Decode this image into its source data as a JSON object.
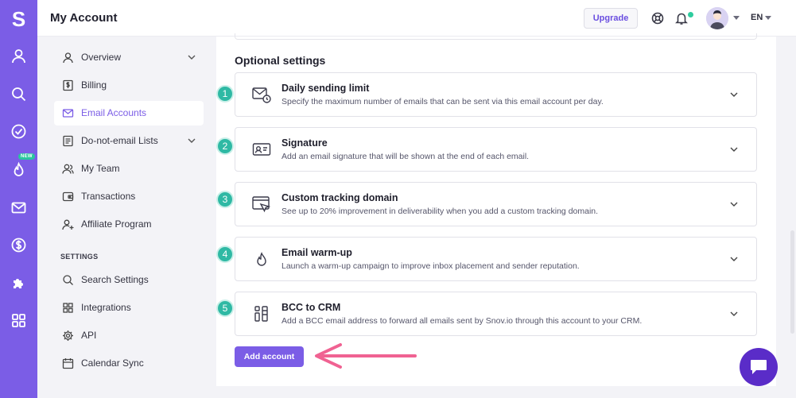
{
  "app": {
    "logo_letter": "S",
    "new_badge": "NEW"
  },
  "header": {
    "title": "My Account",
    "upgrade_label": "Upgrade",
    "language": "EN"
  },
  "sidebar": {
    "items": [
      {
        "label": "Overview",
        "icon": "user-icon",
        "has_chevron": true,
        "active": false
      },
      {
        "label": "Billing",
        "icon": "billing-icon",
        "has_chevron": false,
        "active": false
      },
      {
        "label": "Email Accounts",
        "icon": "mail-icon",
        "has_chevron": false,
        "active": true
      },
      {
        "label": "Do-not-email Lists",
        "icon": "list-icon",
        "has_chevron": true,
        "active": false
      },
      {
        "label": "My Team",
        "icon": "team-icon",
        "has_chevron": false,
        "active": false
      },
      {
        "label": "Transactions",
        "icon": "wallet-icon",
        "has_chevron": false,
        "active": false
      },
      {
        "label": "Affiliate Program",
        "icon": "affiliate-icon",
        "has_chevron": false,
        "active": false
      }
    ],
    "settings_heading": "SETTINGS",
    "settings_items": [
      {
        "label": "Search Settings",
        "icon": "search-icon"
      },
      {
        "label": "Integrations",
        "icon": "integrations-icon"
      },
      {
        "label": "API",
        "icon": "gear-icon"
      },
      {
        "label": "Calendar Sync",
        "icon": "calendar-icon"
      }
    ]
  },
  "main": {
    "section_title": "Optional settings",
    "cards": [
      {
        "number": "1",
        "title": "Daily sending limit",
        "description": "Specify the maximum number of emails that can be sent via this email account per day.",
        "icon": "mail-clock-icon"
      },
      {
        "number": "2",
        "title": "Signature",
        "description": "Add an email signature that will be shown at the end of each email.",
        "icon": "id-card-icon"
      },
      {
        "number": "3",
        "title": "Custom tracking domain",
        "description": "See up to 20% improvement in deliverability when you add a custom tracking domain.",
        "icon": "tracking-icon"
      },
      {
        "number": "4",
        "title": "Email warm-up",
        "description": "Launch a warm-up campaign to improve inbox placement and sender reputation.",
        "icon": "flame-icon"
      },
      {
        "number": "5",
        "title": "BCC to CRM",
        "description": "Add a BCC email address to forward all emails sent by Snov.io through this account to your CRM.",
        "icon": "crm-icon"
      }
    ],
    "add_account_label": "Add account"
  },
  "colors": {
    "brand": "#7b5de6",
    "step_badge": "#2fb9a4",
    "arrow": "#f06292",
    "chat": "#5a2cc8"
  }
}
